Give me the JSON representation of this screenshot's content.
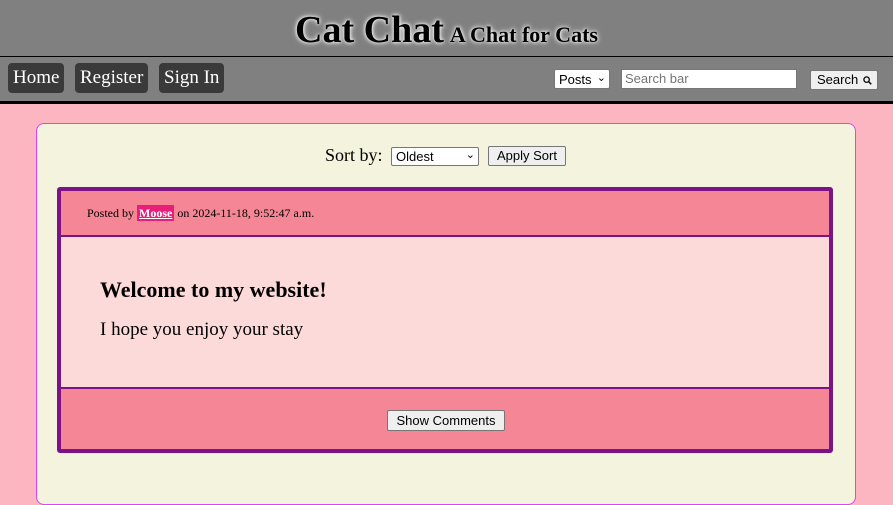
{
  "header": {
    "title": "Cat Chat",
    "subtitle": "A Chat for Cats"
  },
  "nav": {
    "home": "Home",
    "register": "Register",
    "sign_in": "Sign In",
    "search_type": "Posts",
    "search_placeholder": "Search bar",
    "search_button": "Search",
    "search_icon": "magnifier-icon"
  },
  "sort": {
    "label": "Sort by:",
    "selected": "Oldest",
    "apply_button": "Apply Sort"
  },
  "post": {
    "posted_by_prefix": "Posted by",
    "author": "Moose",
    "posted_on": "on 2024-11-18, 9:52:47 a.m.",
    "title": "Welcome to my website!",
    "body": "I hope you enjoy your stay",
    "comments_button": "Show Comments"
  },
  "colors": {
    "page_bg": "#fbb6c1",
    "header_bg": "#808080",
    "panel_bg": "#f3f3de",
    "post_border": "#7b1285",
    "post_header_bg": "#f48695",
    "author_bg": "#e91e7a"
  }
}
